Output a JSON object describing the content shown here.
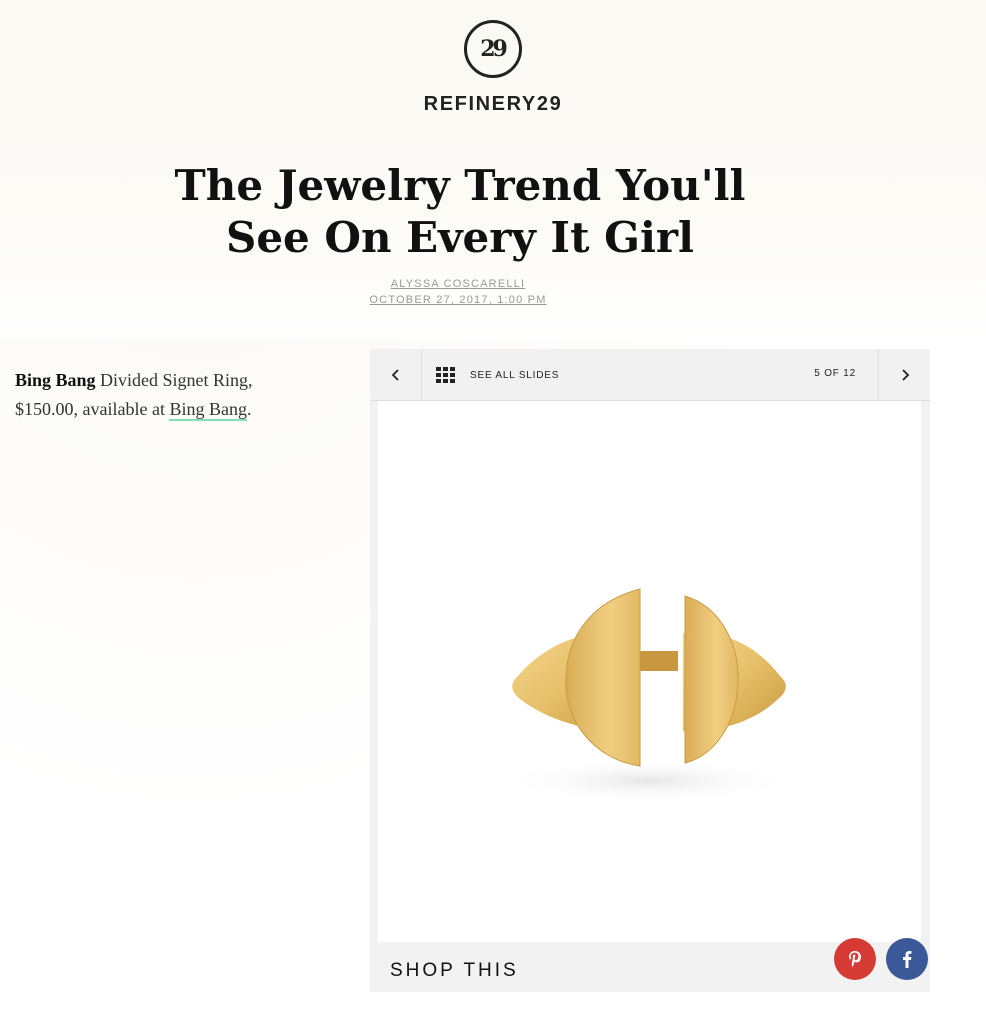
{
  "brand": {
    "name": "REFINERY29",
    "mark": "29"
  },
  "article": {
    "title": "The Jewelry Trend You'll See On Every It Girl",
    "author": "ALYSSA COSCARELLI",
    "date": "OCTOBER 27, 2017, 1:00 PM"
  },
  "caption": {
    "brand": "Bing Bang",
    "text": "Divided Signet Ring, $150.00, available at",
    "link": "Bing Bang",
    "end": "."
  },
  "slideshow": {
    "see_all_label": "SEE ALL SLIDES",
    "counter": "5 OF 12",
    "shop_label": "SHOP THIS",
    "colors": {
      "pinterest": "#d63a35",
      "facebook": "#3b5998",
      "link_underline": "#7fe0b8"
    },
    "icons": [
      "chevron-left-icon",
      "grid-icon",
      "chevron-right-icon",
      "pinterest-icon",
      "facebook-icon"
    ]
  }
}
